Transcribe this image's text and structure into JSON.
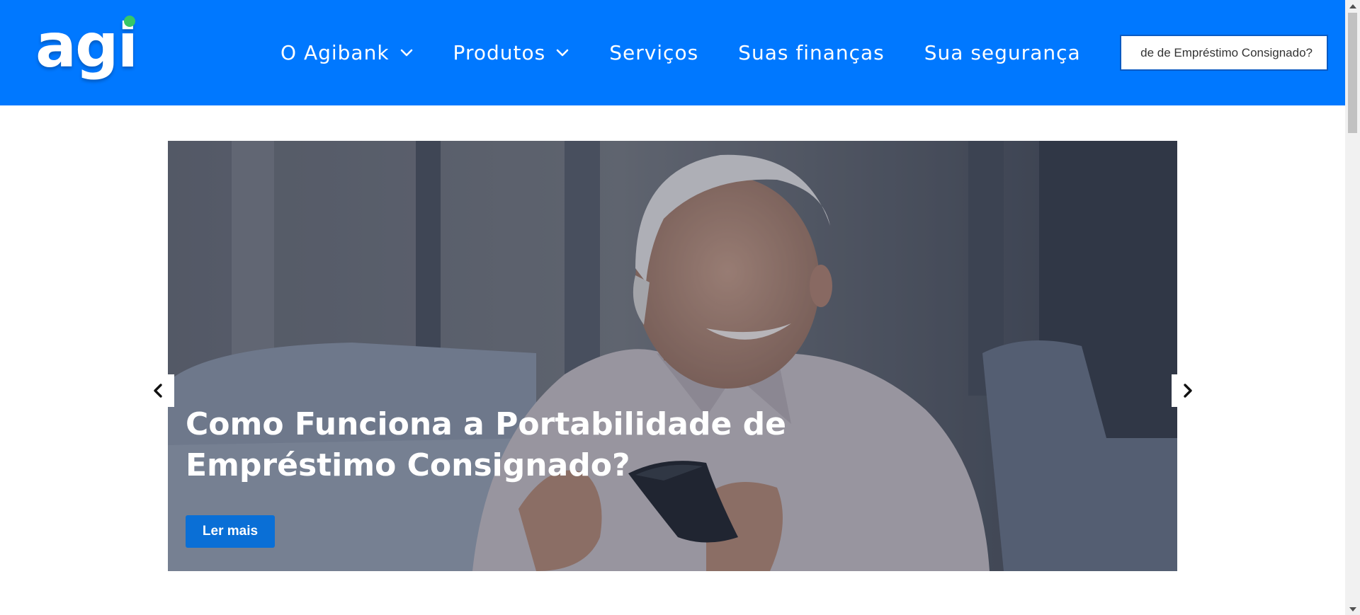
{
  "brand": {
    "logo_text": "agi",
    "dot_color": "#37c768",
    "header_color": "#0078ff"
  },
  "nav": {
    "items": [
      {
        "label": "O Agibank",
        "has_dropdown": true
      },
      {
        "label": "Produtos",
        "has_dropdown": true
      },
      {
        "label": "Serviços",
        "has_dropdown": false
      },
      {
        "label": "Suas finanças",
        "has_dropdown": false
      },
      {
        "label": "Sua segurança",
        "has_dropdown": false
      }
    ]
  },
  "search": {
    "value": "de de Empréstimo Consignado?"
  },
  "carousel": {
    "slide_title": "Como Funciona a Portabilidade de Empréstimo Consignado?",
    "button_label": "Ler mais",
    "prev_icon": "chevron-left-icon",
    "next_icon": "chevron-right-icon",
    "button_color": "#0a6fd6"
  }
}
